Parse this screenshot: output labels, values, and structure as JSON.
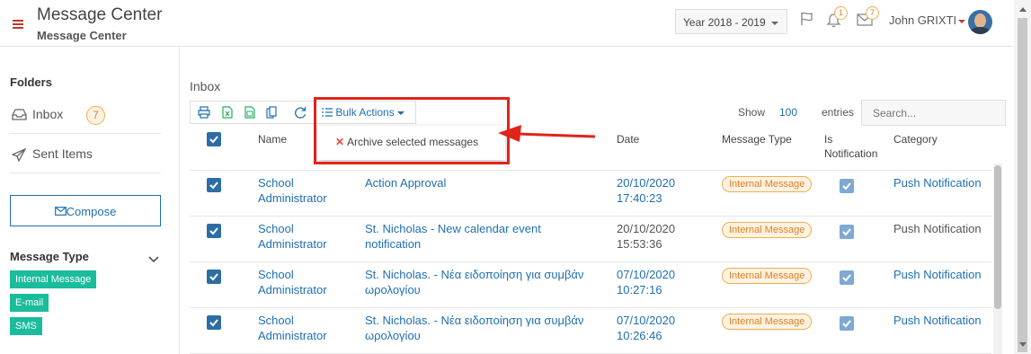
{
  "header": {
    "title": "Message Center",
    "subtitle": "Message Center",
    "year": "Year 2018 - 2019",
    "bell_count": "1",
    "mail_count": "7",
    "user_name": "John GRIXTI"
  },
  "sidebar": {
    "folders_heading": "Folders",
    "items": [
      {
        "label": "Inbox",
        "count": "7",
        "icon": "inbox-icon"
      },
      {
        "label": "Sent Items",
        "icon": "paper-plane-icon"
      }
    ],
    "compose_label": "Compose",
    "message_type_heading": "Message Type",
    "tags": [
      "Internal Message",
      "E-mail",
      "SMS"
    ]
  },
  "main": {
    "title": "Inbox",
    "bulk_actions_label": "Bulk Actions",
    "show_label": "Show",
    "show_value": "100",
    "entries_label": "entries",
    "search_placeholder": "Search...",
    "dropdown_item": "Archive selected messages",
    "columns": [
      "Name",
      "Date",
      "Message Type",
      "Is Notification",
      "Category"
    ],
    "rows": [
      {
        "name": "School Administrator",
        "subject": "Action Approval",
        "date": "20/10/2020",
        "time": "17:40:23",
        "type": "Internal Message",
        "category": "Push Notification",
        "unread": true
      },
      {
        "name": "School Administrator",
        "subject": "St. Nicholas - New calendar event notification",
        "date": "20/10/2020",
        "time": "15:53:36",
        "type": "Internal Message",
        "category": "Push Notification",
        "unread": false
      },
      {
        "name": "School Administrator",
        "subject": "St. Nicholas. - Νέα ειδοποίηση για συμβάν ωρολογίου",
        "date": "07/10/2020",
        "time": "10:27:16",
        "type": "Internal Message",
        "category": "Push Notification",
        "unread": true
      },
      {
        "name": "School Administrator",
        "subject": "St. Nicholas. - Νέα ειδοποίηση για συμβάν ωρολογίου",
        "date": "07/10/2020",
        "time": "10:26:46",
        "type": "Internal Message",
        "category": "Push Notification",
        "unread": true
      }
    ]
  },
  "colors": {
    "accent": "#1f6fb2",
    "badge_orange": "#e67e22",
    "tag_green": "#1abc9c",
    "highlight_red": "#e2231a"
  }
}
